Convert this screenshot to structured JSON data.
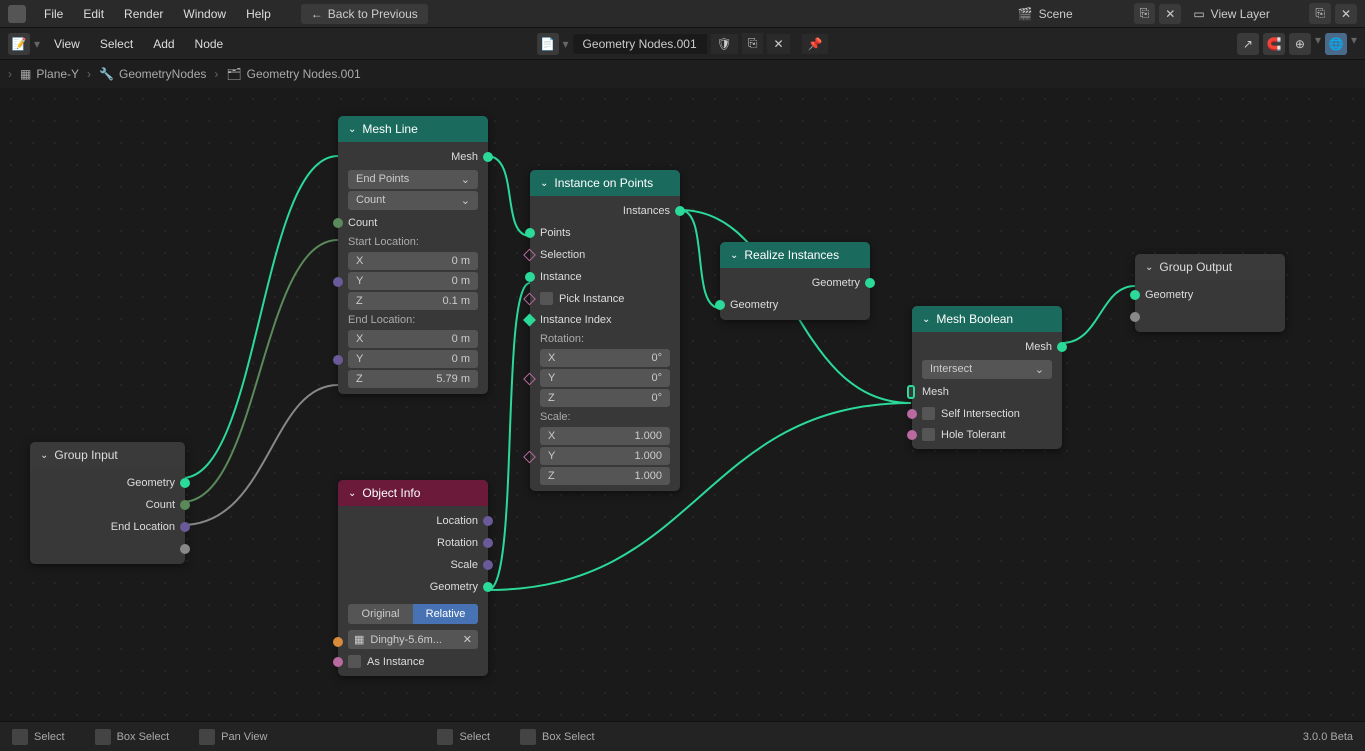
{
  "menu": {
    "items": [
      "File",
      "Edit",
      "Render",
      "Window",
      "Help"
    ],
    "back": "Back to Previous"
  },
  "header": {
    "scene": "Scene",
    "viewlayer": "View Layer"
  },
  "toolbar": {
    "items": [
      "View",
      "Select",
      "Add",
      "Node"
    ],
    "nodegroup": "Geometry Nodes.001"
  },
  "breadcrumb": {
    "obj": "Plane-Y",
    "mod": "GeometryNodes",
    "ng": "Geometry Nodes.001"
  },
  "nodes": {
    "groupInput": {
      "title": "Group Input",
      "outs": [
        "Geometry",
        "Count",
        "End Location"
      ]
    },
    "meshLine": {
      "title": "Mesh Line",
      "mode": "End Points",
      "countMode": "Count",
      "countLabel": "Count",
      "startLabel": "Start Location:",
      "start": {
        "x": "0 m",
        "y": "0 m",
        "z": "0.1 m"
      },
      "endLabel": "End Location:",
      "end": {
        "x": "0 m",
        "y": "0 m",
        "z": "5.79 m"
      },
      "out": "Mesh"
    },
    "objectInfo": {
      "title": "Object Info",
      "outs": [
        "Location",
        "Rotation",
        "Scale",
        "Geometry"
      ],
      "segOriginal": "Original",
      "segRelative": "Relative",
      "object": "Dinghy-5.6m...",
      "asInstance": "As Instance"
    },
    "instanceOnPoints": {
      "title": "Instance on Points",
      "out": "Instances",
      "ins": [
        "Points",
        "Selection",
        "Instance",
        "Pick Instance",
        "Instance Index"
      ],
      "rotLabel": "Rotation:",
      "rot": {
        "x": "0°",
        "y": "0°",
        "z": "0°"
      },
      "scaleLabel": "Scale:",
      "scale": {
        "x": "1.000",
        "y": "1.000",
        "z": "1.000"
      }
    },
    "realize": {
      "title": "Realize Instances",
      "out": "Geometry",
      "in": "Geometry"
    },
    "boolean": {
      "title": "Mesh Boolean",
      "out": "Mesh",
      "mode": "Intersect",
      "in1": "Mesh",
      "selfInt": "Self Intersection",
      "holeTol": "Hole Tolerant"
    },
    "groupOutput": {
      "title": "Group Output",
      "in": "Geometry"
    }
  },
  "statusbar": {
    "select": "Select",
    "boxselect": "Box Select",
    "pan": "Pan View",
    "version": "3.0.0 Beta"
  }
}
